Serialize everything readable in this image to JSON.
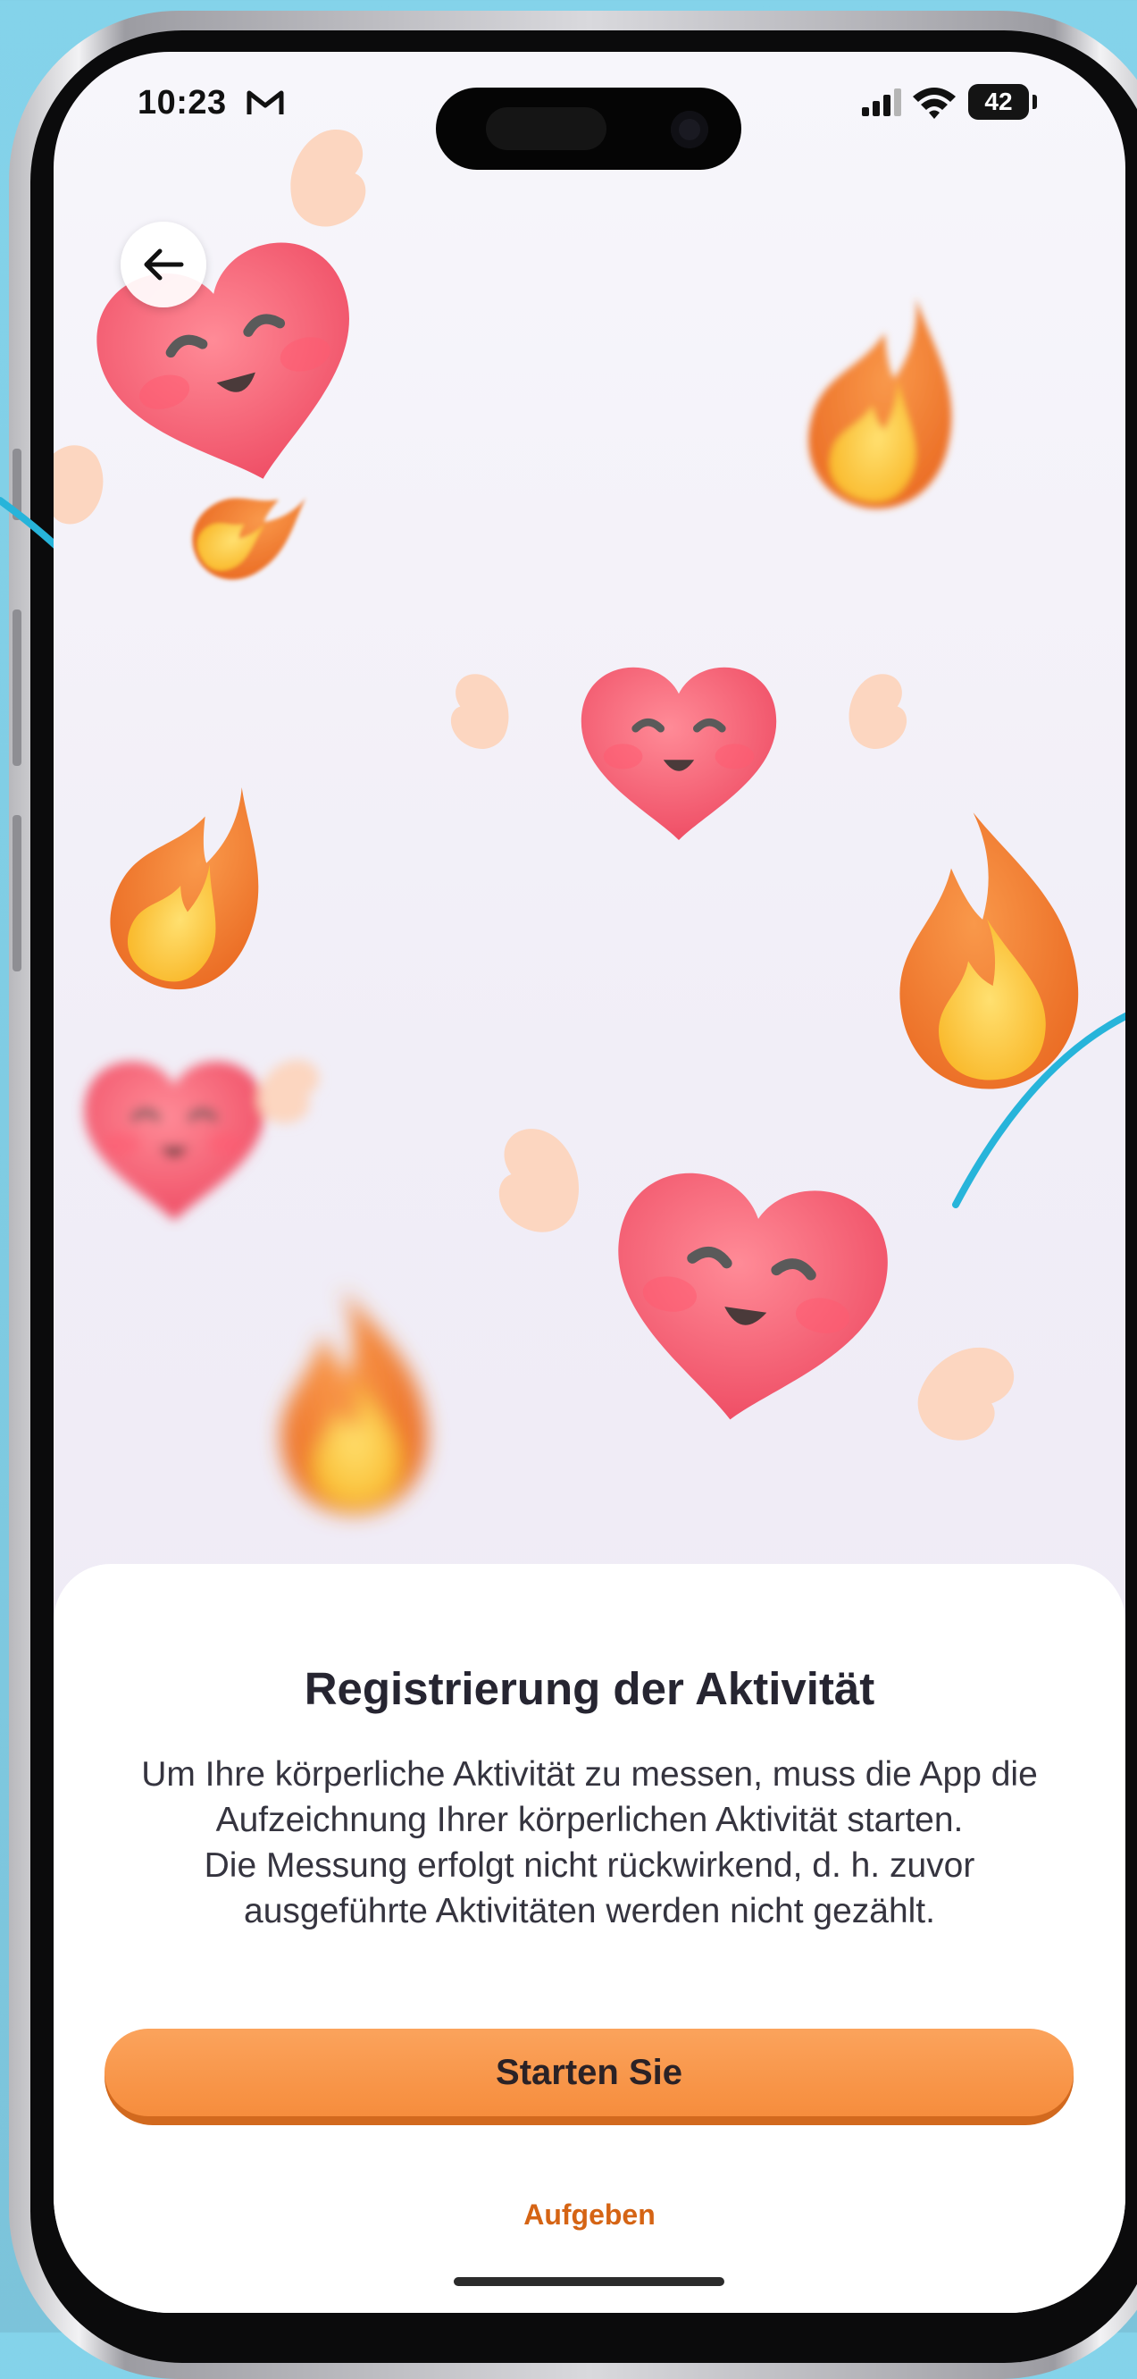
{
  "status_bar": {
    "time": "10:23",
    "battery": "42"
  },
  "icons": {
    "back": "arrow-left-icon",
    "mail": "gmail-icon",
    "signal": "cellular-signal-icon",
    "wifi": "wifi-icon",
    "battery": "battery-icon"
  },
  "sheet": {
    "title": "Registrierung der Aktivität",
    "paragraph1": "Um Ihre körperliche Aktivität zu messen, muss die App die Aufzeichnung Ihrer körperlichen Aktivität starten.",
    "paragraph2": "Die Messung erfolgt nicht rückwirkend, d. h. zuvor ausgeführte Aktivitäten werden nicht gezählt.",
    "primary_button": "Starten Sie",
    "secondary_link": "Aufgeben"
  },
  "colors": {
    "accent": "#f68d3d",
    "accent_dark": "#d2691e",
    "link": "#d56414",
    "title": "#262531",
    "background": "#84d3ea"
  }
}
